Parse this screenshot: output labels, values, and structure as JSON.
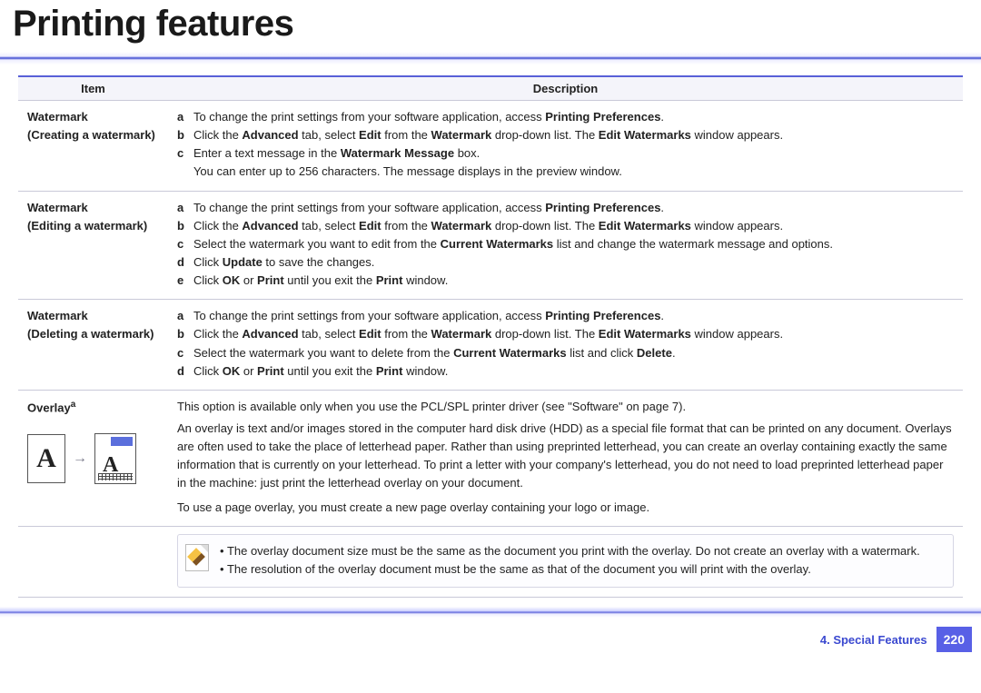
{
  "page_title": "Printing features",
  "table_headers": {
    "item": "Item",
    "description": "Description"
  },
  "rows": {
    "create": {
      "item_line1": "Watermark",
      "item_line2": "(Creating a watermark)",
      "a_pre": "To change the print settings from your software application, access ",
      "a_bold": "Printing Preferences",
      "a_post": ".",
      "b_parts": [
        "Click the ",
        "Advanced",
        " tab, select ",
        "Edit",
        " from the ",
        "Watermark",
        " drop-down list. The ",
        "Edit Watermarks",
        " window appears."
      ],
      "c_parts": [
        "Enter a text message in the ",
        "Watermark Message",
        " box."
      ],
      "c_sub": "You can enter up to 256 characters. The message displays in the preview window."
    },
    "edit": {
      "item_line1": "Watermark",
      "item_line2": "(Editing a watermark)",
      "a_pre": "To change the print settings from your software application, access ",
      "a_bold": "Printing Preferences",
      "a_post": ".",
      "b_parts": [
        "Click the ",
        "Advanced",
        " tab, select ",
        "Edit",
        " from the ",
        "Watermark",
        " drop-down list. The ",
        "Edit Watermarks",
        " window appears."
      ],
      "c_parts": [
        "Select the watermark you want to edit from the ",
        "Current Watermarks",
        " list and change the watermark message and options."
      ],
      "d_parts": [
        "Click ",
        "Update",
        " to save the changes."
      ],
      "e_parts": [
        "Click ",
        "OK",
        " or ",
        "Print",
        " until you exit the ",
        "Print",
        " window."
      ]
    },
    "delete": {
      "item_line1": "Watermark",
      "item_line2": "(Deleting a watermark)",
      "a_pre": "To change the print settings from your software application, access ",
      "a_bold": "Printing Preferences",
      "a_post": ".",
      "b_parts": [
        "Click the ",
        "Advanced",
        " tab, select ",
        "Edit",
        " from the ",
        "Watermark",
        " drop-down list. The ",
        "Edit Watermarks",
        " window appears."
      ],
      "c_parts": [
        "Select the watermark you want to delete from the ",
        "Current Watermarks",
        " list and click ",
        "Delete",
        "."
      ],
      "d_parts": [
        "Click ",
        "OK",
        " or ",
        "Print",
        " until you exit the ",
        "Print",
        " window."
      ]
    },
    "overlay": {
      "item_label": "Overlay",
      "item_super": "a",
      "para1": "This option is available only when you use the PCL/SPL printer driver (see \"Software\" on page 7).",
      "para2": "An overlay is text and/or images stored in the computer hard disk drive (HDD) as a special file format that can be printed on any document. Overlays are often used to take the place of letterhead paper. Rather than using preprinted letterhead, you can create an overlay containing exactly the same information that is currently on your letterhead. To print a letter with your company's letterhead, you do not need to load preprinted letterhead paper in the machine: just print the letterhead overlay on your document.",
      "para3": "To use a page overlay, you must create a new page overlay containing your logo or image.",
      "illus_A": "A"
    },
    "note": {
      "n1": "The overlay document size must be the same as the document you print with the overlay. Do not create an overlay with a watermark.",
      "n2": "The resolution of the overlay document must be the same as that of the document you will print with the overlay."
    }
  },
  "footer": {
    "chapter": "4.  Special Features",
    "page": "220"
  }
}
